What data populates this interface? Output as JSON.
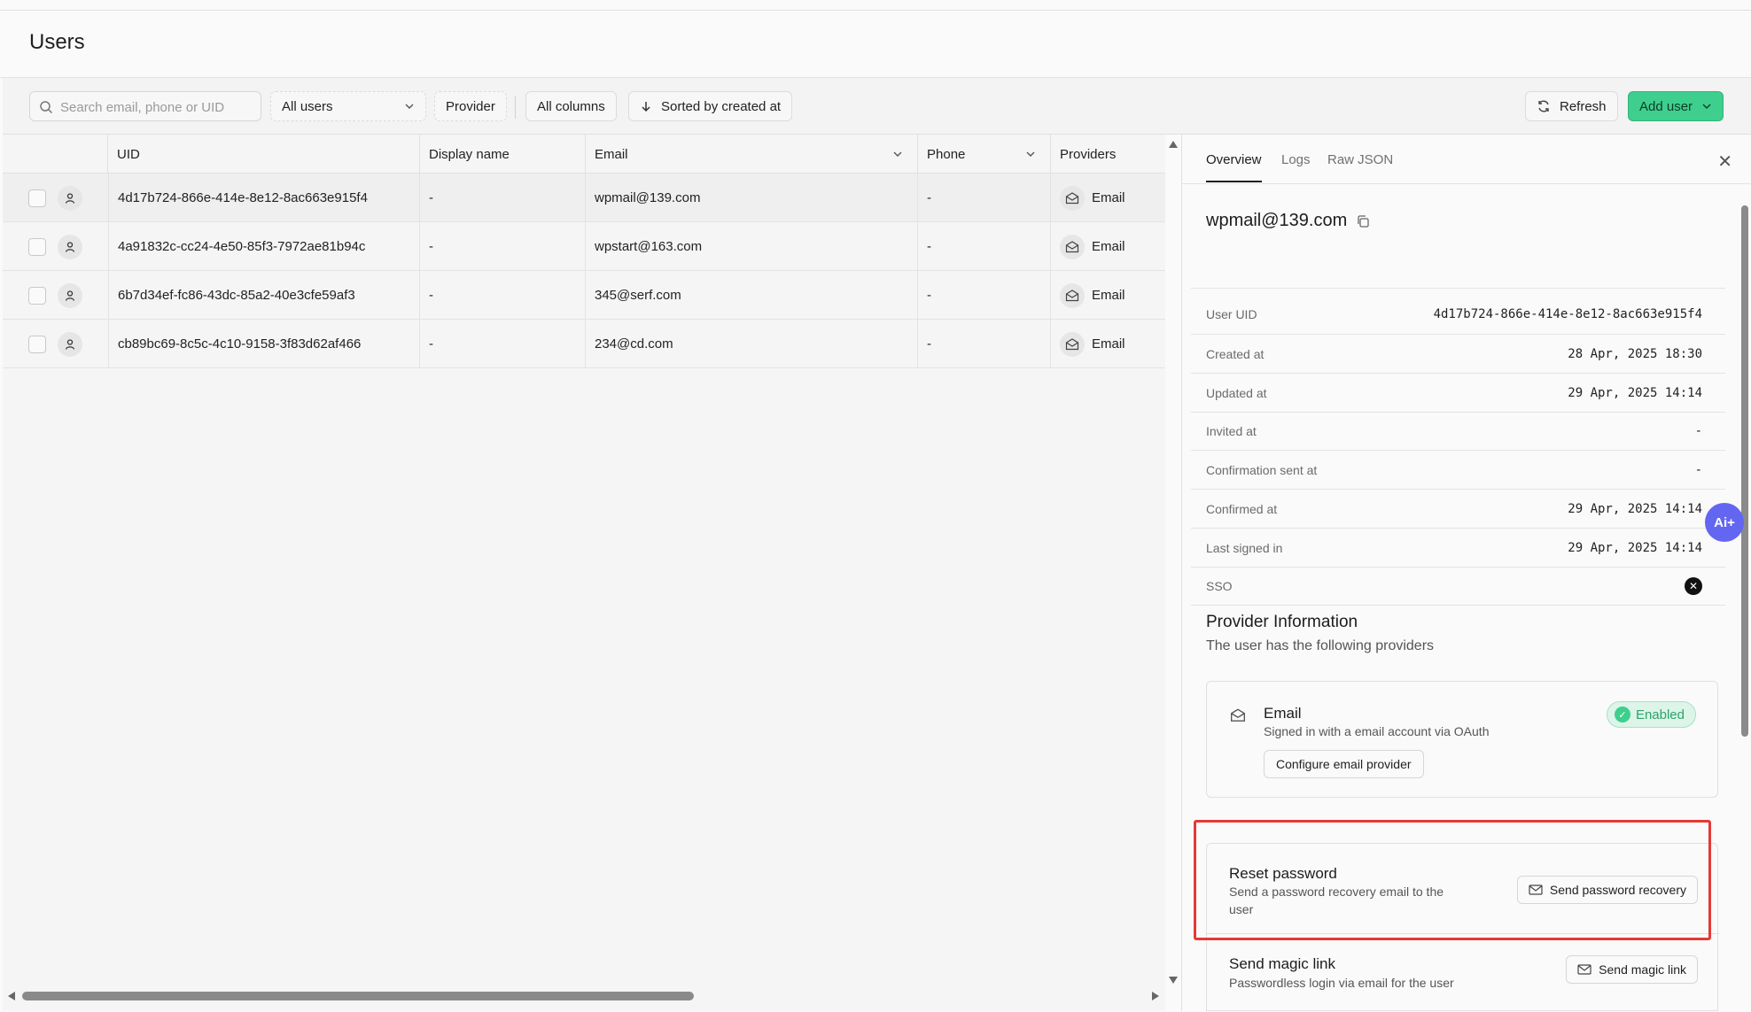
{
  "header": {
    "title": "Users"
  },
  "toolbar": {
    "search_placeholder": "Search email, phone or UID",
    "filter_label": "All users",
    "provider_label": "Provider",
    "columns_label": "All columns",
    "sort_label": "Sorted by created at",
    "refresh_label": "Refresh",
    "add_user_label": "Add user"
  },
  "table": {
    "columns": [
      "UID",
      "Display name",
      "Email",
      "Phone",
      "Providers"
    ],
    "rows": [
      {
        "uid": "4d17b724-866e-414e-8e12-8ac663e915f4",
        "display_name": "-",
        "email": "wpmail@139.com",
        "phone": "-",
        "provider": "Email"
      },
      {
        "uid": "4a91832c-cc24-4e50-85f3-7972ae81b94c",
        "display_name": "-",
        "email": "wpstart@163.com",
        "phone": "-",
        "provider": "Email"
      },
      {
        "uid": "6b7d34ef-fc86-43dc-85a2-40e3cfe59af3",
        "display_name": "-",
        "email": "345@serf.com",
        "phone": "-",
        "provider": "Email"
      },
      {
        "uid": "cb89bc69-8c5c-4c10-9158-3f83d62af466",
        "display_name": "-",
        "email": "234@cd.com",
        "phone": "-",
        "provider": "Email"
      }
    ]
  },
  "panel": {
    "tabs": [
      "Overview",
      "Logs",
      "Raw JSON"
    ],
    "close_label": "✕",
    "email": "wpmail@139.com",
    "fields": [
      {
        "label": "User UID",
        "value": "4d17b724-866e-414e-8e12-8ac663e915f4"
      },
      {
        "label": "Created at",
        "value": "28 Apr, 2025 18:30"
      },
      {
        "label": "Updated at",
        "value": "29 Apr, 2025 14:14"
      },
      {
        "label": "Invited at",
        "value": "-"
      },
      {
        "label": "Confirmation sent at",
        "value": "-"
      },
      {
        "label": "Confirmed at",
        "value": "29 Apr, 2025 14:14"
      },
      {
        "label": "Last signed in",
        "value": "29 Apr, 2025 14:14"
      },
      {
        "label": "SSO",
        "value": ""
      }
    ],
    "provider_section": {
      "title": "Provider Information",
      "subtitle": "The user has the following providers",
      "provider_name": "Email",
      "provider_desc": "Signed in with a email account via OAuth",
      "configure_label": "Configure email provider",
      "status": "Enabled"
    },
    "actions": {
      "reset_title": "Reset password",
      "reset_desc": "Send a password recovery email to the user",
      "reset_button": "Send password recovery",
      "magic_title": "Send magic link",
      "magic_desc": "Passwordless login via email for the user",
      "magic_button": "Send magic link"
    }
  },
  "assistant": {
    "label": "Ai+"
  },
  "colors": {
    "accent_green": "#3ecf8e",
    "highlight_red": "#e53935",
    "assistant_purple": "#6366f1"
  }
}
